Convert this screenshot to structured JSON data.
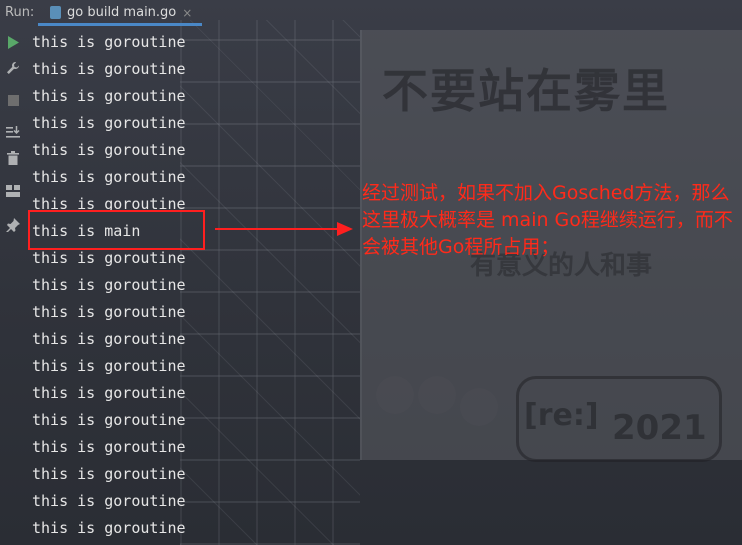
{
  "header": {
    "run_label": "Run:",
    "tab_label": "go build main.go",
    "tab_icon": "go-file-icon"
  },
  "toolbar": {
    "buttons": [
      "play-icon",
      "wrench-icon",
      "stop-icon",
      "sort-icon",
      "trash-icon",
      "layout-icon",
      "pin-icon"
    ]
  },
  "console": {
    "lines": [
      "this is goroutine",
      "this is goroutine",
      "this is goroutine",
      "this is goroutine",
      "this is goroutine",
      "this is goroutine",
      "this is goroutine",
      "this is main",
      "this is goroutine",
      "this is goroutine",
      "this is goroutine",
      "this is goroutine",
      "this is goroutine",
      "this is goroutine",
      "this is goroutine",
      "this is goroutine",
      "this is goroutine",
      "this is goroutine",
      "this is goroutine"
    ]
  },
  "annotation": {
    "note": "经过测试，如果不加入Gosched方法，那么这里极大概率是 main Go程继续运行，而不会被其他Go程所占用；",
    "color": "#ff2a1a"
  },
  "background": {
    "billboard_line1": "不要站在雾里",
    "billboard_subtitle": "有意义的人和事",
    "billboard_year": "2021",
    "billboard_tag": "[re:]"
  }
}
